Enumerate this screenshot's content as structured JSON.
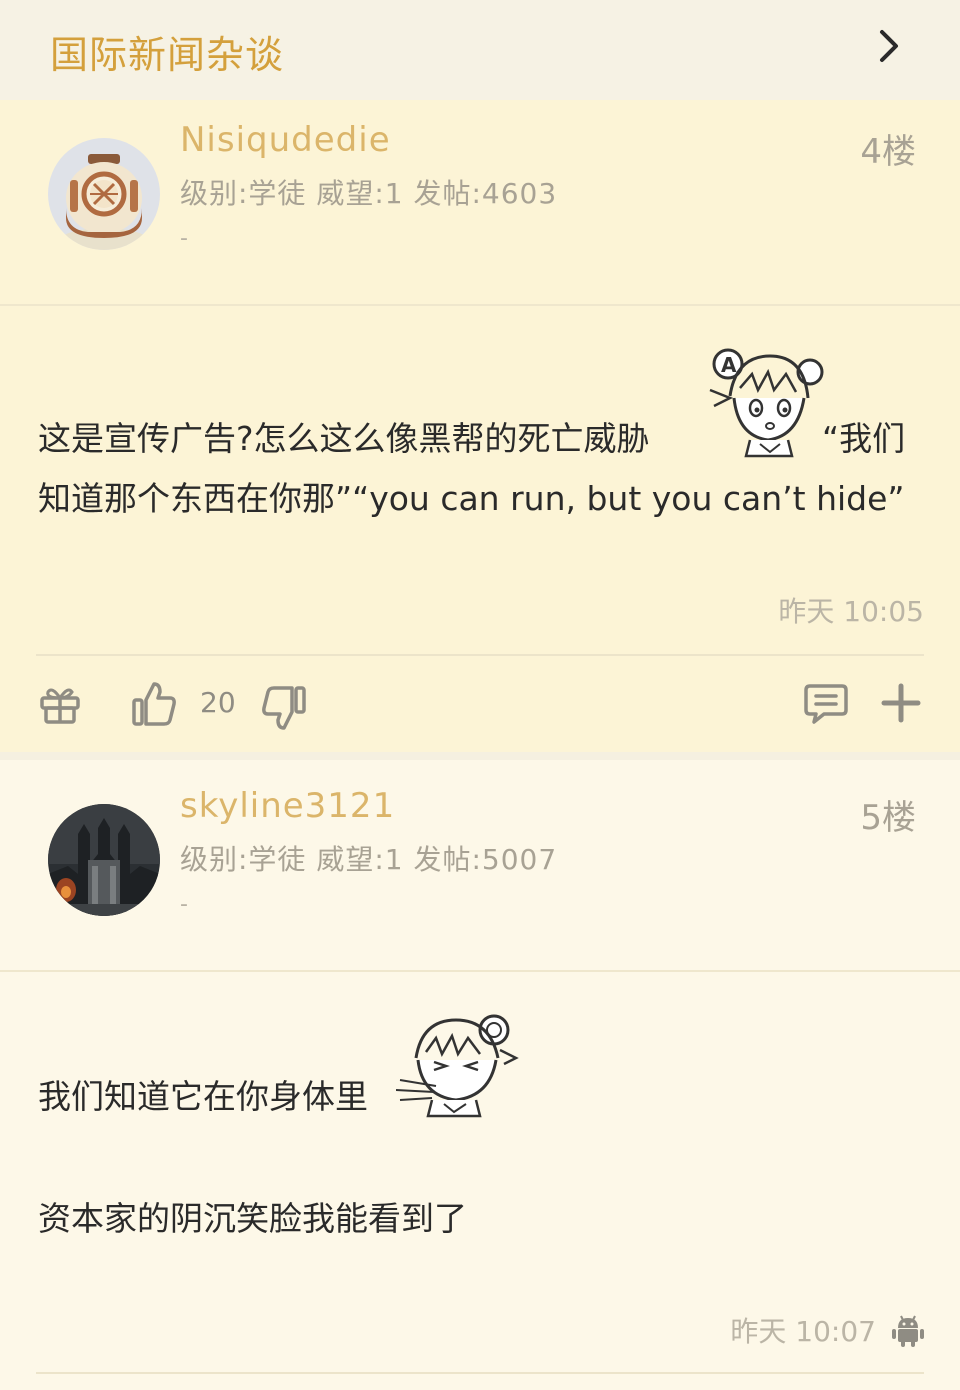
{
  "header": {
    "title": "国际新闻杂谈"
  },
  "posts": [
    {
      "username": "Nisiqudedie",
      "meta": "级别:学徒 威望:1 发帖:4603",
      "signature": "-",
      "floor": "4楼",
      "content_line1": "这是宣传广告?怎么这么像黑帮的死亡威胁",
      "content_line1_tail": "“我们",
      "content_line2": "知道那个东西在你那”“you can run, but you can’t hide”",
      "time": "昨天 10:05",
      "likes": "20"
    },
    {
      "username": "skyline3121",
      "meta": "级别:学徒 威望:1 发帖:5007",
      "signature": "-",
      "floor": "5楼",
      "content_line1": "我们知道它在你身体里",
      "content_line2": "资本家的阴沉笑脸我能看到了",
      "time": "昨天 10:07"
    }
  ],
  "icons": {
    "header": "chevron-right-icon",
    "gift": "gift-icon",
    "like": "thumbs-up-icon",
    "dislike": "thumbs-down-icon",
    "comment": "comment-icon",
    "more": "plus-icon",
    "platform": "android-icon"
  },
  "colors": {
    "accent": "#d4a03c",
    "username": "#dbb56a",
    "post_bg_highlight": "#fcf4d6",
    "post_bg": "#fdf8e8"
  }
}
